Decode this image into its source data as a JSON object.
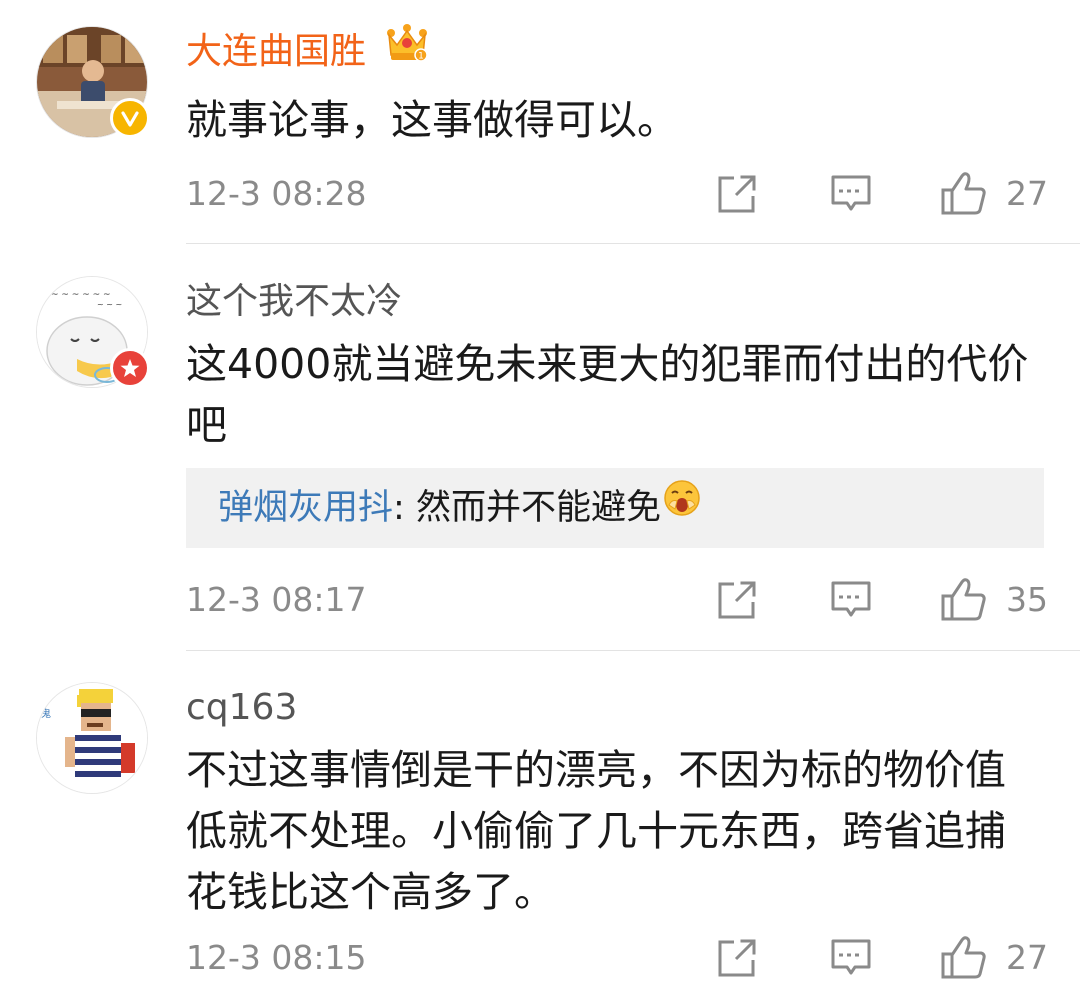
{
  "comments": [
    {
      "username": "大连曲国胜",
      "text": "就事论事，这事做得可以。",
      "time": "12-3 08:28",
      "likes": "27",
      "user_type": "vip",
      "badge": "verified-yellow-v"
    },
    {
      "username": "这个我不太冷",
      "text": "这4000就当避免未来更大的犯罪而付出的代价吧",
      "time": "12-3 08:17",
      "likes": "35",
      "badge": "red-star",
      "reply": {
        "user": "弹烟灰用抖",
        "separator": ":",
        "text": " 然而并不能避免",
        "emoji": "yawn-face"
      }
    },
    {
      "username": "cq163",
      "text": "不过这事情倒是干的漂亮，不因为标的物价值低就不处理。小偷偷了几十元东西，跨省追捕花钱比这个高多了。",
      "time": "12-3 08:15",
      "likes": "27"
    }
  ],
  "icons": {
    "repost": "repost-icon",
    "comment": "comment-icon",
    "like": "like-thumb-icon"
  },
  "colors": {
    "vip_name": "#f26318",
    "reply_name": "#3d7ab8",
    "meta": "#8a8a8a"
  }
}
